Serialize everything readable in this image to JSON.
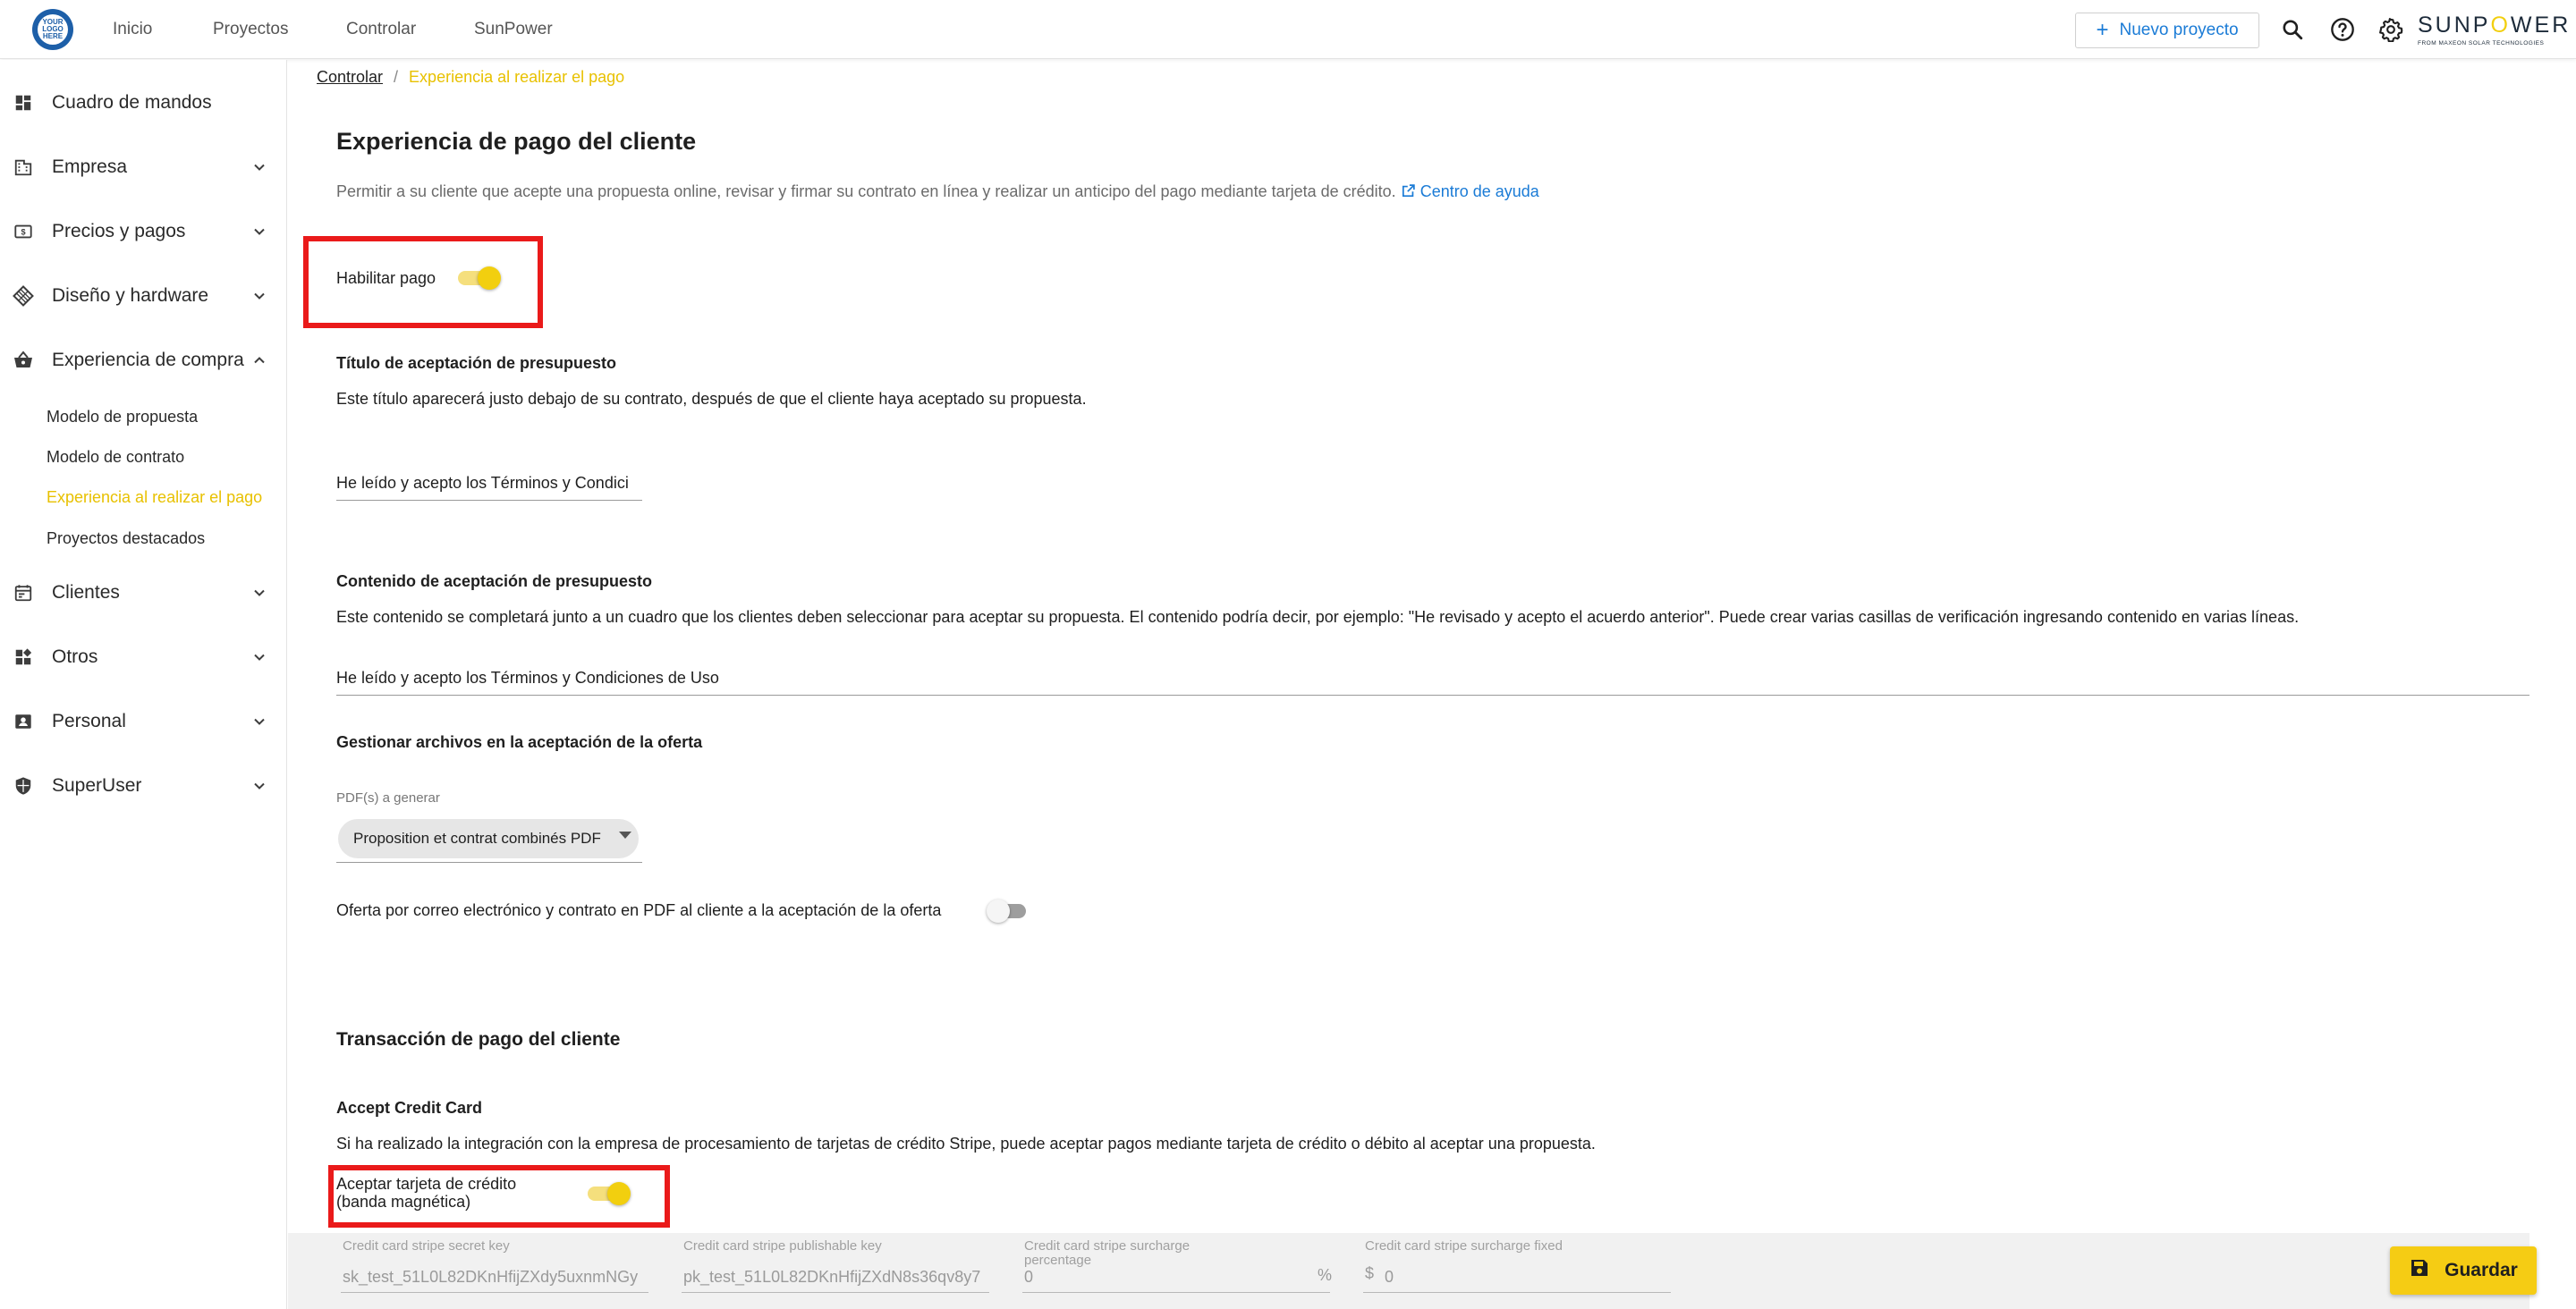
{
  "logo": {
    "text": "YOUR LOGO HERE"
  },
  "topnav": {
    "items": [
      "Inicio",
      "Proyectos",
      "Controlar",
      "SunPower"
    ]
  },
  "header": {
    "new_project_label": "Nuevo proyecto",
    "brand_name": "SUNPOWER",
    "brand_sub": "FROM MAXEON SOLAR TECHNOLOGIES"
  },
  "sidebar": {
    "items": [
      {
        "label": "Cuadro de mandos",
        "icon": "dashboard-icon"
      },
      {
        "label": "Empresa",
        "icon": "building-icon"
      },
      {
        "label": "Precios y pagos",
        "icon": "price-icon"
      },
      {
        "label": "Diseño y hardware",
        "icon": "solar-panel-icon"
      },
      {
        "label": "Experiencia de compra",
        "icon": "basket-icon"
      },
      {
        "label": "Clientes",
        "icon": "calendar-icon"
      },
      {
        "label": "Otros",
        "icon": "widgets-icon"
      },
      {
        "label": "Personal",
        "icon": "contact-card-icon"
      },
      {
        "label": "SuperUser",
        "icon": "shield-icon"
      }
    ],
    "subitems": [
      "Modelo de propuesta",
      "Modelo de contrato",
      "Experiencia al realizar el pago",
      "Proyectos destacados"
    ]
  },
  "breadcrumb": {
    "parent": "Controlar",
    "separator": "/",
    "current": "Experiencia al realizar el pago"
  },
  "main": {
    "title": "Experiencia de pago del cliente",
    "description": "Permitir a su cliente que acepte una propuesta online, revisar y firmar su contrato en línea y realizar un anticipo del pago mediante tarjeta de crédito.",
    "help_link": "Centro de ayuda",
    "enable_payment_label": "Habilitar pago",
    "enable_payment_on": true,
    "acceptance_title_heading": "Título de aceptación de presupuesto",
    "acceptance_title_desc": "Este título aparecerá justo debajo de su contrato, después de que el cliente haya aceptado su propuesta.",
    "acceptance_title_value": "He leído y acepto los Términos y Condici",
    "acceptance_content_heading": "Contenido de aceptación de presupuesto",
    "acceptance_content_desc": "Este contenido se completará junto a un cuadro que los clientes deben seleccionar para aceptar su propuesta. El contenido podría decir, por ejemplo: \"He revisado y acepto el acuerdo anterior\". Puede crear varias casillas de verificación ingresando contenido en varias líneas.",
    "acceptance_content_value": "He leído y acepto los Términos y Condiciones de Uso",
    "files_heading": "Gestionar archivos en la aceptación de la oferta",
    "pdf_label": "PDF(s) a generar",
    "pdf_selected": "Proposition et contrat combinés PDF",
    "email_pdf_label": "Oferta por correo electrónico y contrato en PDF al cliente a la aceptación de la oferta",
    "email_pdf_on": false,
    "transaction_heading": "Transacción de pago del cliente",
    "accept_cc_heading": "Accept Credit Card",
    "accept_cc_desc": "Si ha realizado la integración con la empresa de procesamiento de tarjetas de crédito Stripe, puede aceptar pagos mediante tarjeta de crédito o débito al aceptar una propuesta.",
    "accept_cc_toggle_label_1": "Aceptar tarjeta de crédito",
    "accept_cc_toggle_label_2": "(banda magnética)",
    "accept_cc_on": true
  },
  "stripe": {
    "secret_key_label": "Credit card stripe secret key",
    "secret_key_value": "sk_test_51L0L82DKnHfijZXdy5uxnmNGy",
    "publishable_key_label": "Credit card stripe publishable key",
    "publishable_key_value": "pk_test_51L0L82DKnHfijZXdN8s36qv8y7",
    "surcharge_pct_label_1": "Credit card stripe surcharge",
    "surcharge_pct_label_2": "percentage",
    "surcharge_pct_value": "0",
    "surcharge_pct_unit": "%",
    "surcharge_fixed_label": "Credit card stripe surcharge fixed",
    "surcharge_fixed_currency": "$",
    "surcharge_fixed_value": "0"
  },
  "save_label": "Guardar",
  "colors": {
    "accent": "#f2cf0f",
    "link": "#1a7bd6",
    "highlight_box": "#ea1a1a"
  }
}
